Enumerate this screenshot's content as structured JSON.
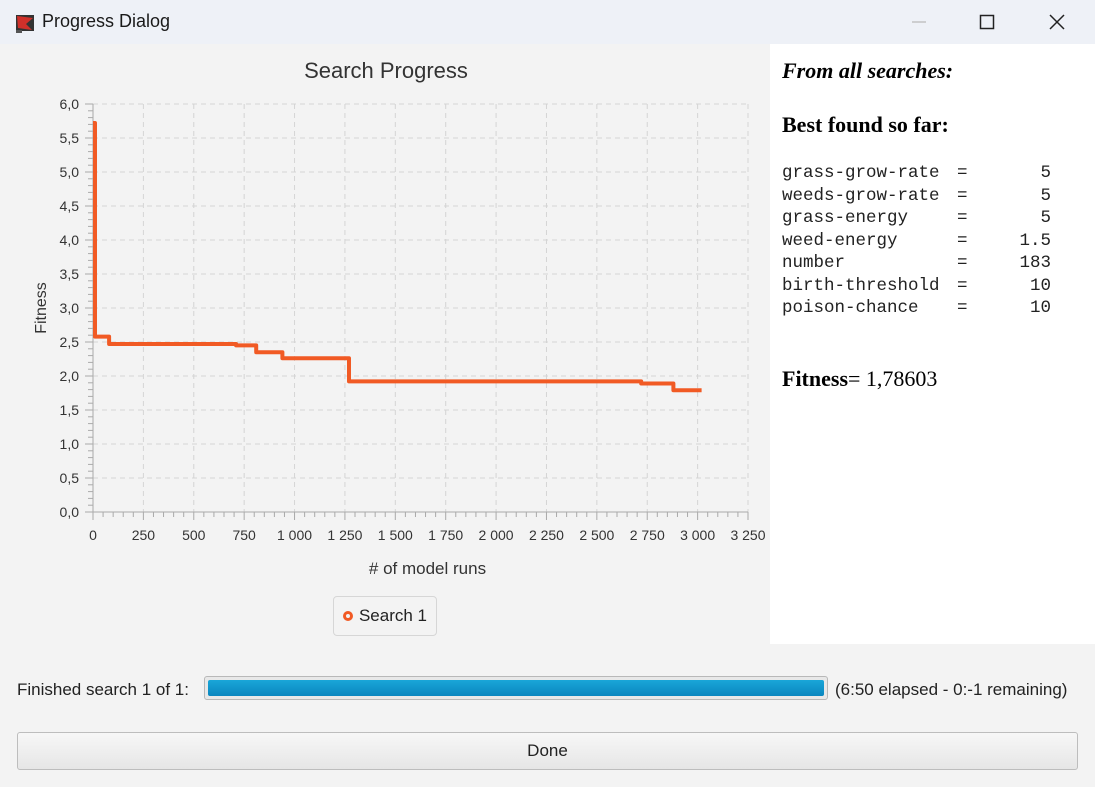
{
  "window": {
    "title": "Progress Dialog",
    "buttons": {
      "minimize": "minimize-icon",
      "maximize": "maximize-icon",
      "close": "close-icon"
    }
  },
  "chart_data": {
    "type": "line",
    "title": "Search Progress",
    "xlabel": "# of model runs",
    "ylabel": "Fitness",
    "xlim": [
      0,
      3250
    ],
    "ylim": [
      0,
      6.0
    ],
    "x_ticks": [
      0,
      250,
      500,
      750,
      1000,
      1250,
      1500,
      1750,
      2000,
      2250,
      2500,
      2750,
      3000,
      3250
    ],
    "x_tick_labels": [
      "0",
      "250",
      "500",
      "750",
      "1 000",
      "1 250",
      "1 500",
      "1 750",
      "2 000",
      "2 250",
      "2 500",
      "2 750",
      "3 000",
      "3 250"
    ],
    "y_ticks": [
      0,
      0.5,
      1.0,
      1.5,
      2.0,
      2.5,
      3.0,
      3.5,
      4.0,
      4.5,
      5.0,
      5.5,
      6.0
    ],
    "y_tick_labels": [
      "0,0",
      "0,5",
      "1,0",
      "1,5",
      "2,0",
      "2,5",
      "3,0",
      "3,5",
      "4,0",
      "4,5",
      "5,0",
      "5,5",
      "6,0"
    ],
    "grid": true,
    "legend_position": "bottom",
    "series": [
      {
        "name": "Search 1",
        "color": "#f15a24",
        "x": [
          0,
          10,
          10,
          80,
          80,
          710,
          710,
          810,
          810,
          940,
          940,
          1270,
          1270,
          2720,
          2720,
          2880,
          2880,
          3020
        ],
        "y": [
          5.72,
          5.72,
          2.58,
          2.58,
          2.47,
          2.47,
          2.45,
          2.45,
          2.35,
          2.35,
          2.26,
          2.26,
          1.92,
          1.92,
          1.89,
          1.89,
          1.79,
          1.79
        ]
      }
    ]
  },
  "results": {
    "heading_all": "From all searches:",
    "heading_best": "Best found so far:",
    "params": [
      {
        "name": "grass-grow-rate",
        "eq": "=",
        "value": "5"
      },
      {
        "name": "weeds-grow-rate",
        "eq": "=",
        "value": "5"
      },
      {
        "name": "grass-energy",
        "eq": "=",
        "value": "5"
      },
      {
        "name": "weed-energy",
        "eq": "=",
        "value": "1.5"
      },
      {
        "name": "number",
        "eq": "=",
        "value": "183"
      },
      {
        "name": "birth-threshold",
        "eq": "=",
        "value": "10"
      },
      {
        "name": "poison-chance",
        "eq": "=",
        "value": "10"
      }
    ],
    "fitness_label": "Fitness",
    "fitness_value": "= 1,78603"
  },
  "status": {
    "label": "Finished search 1 of 1:",
    "progress": 1.0,
    "elapsed_text": "(6:50 elapsed - 0:-1 remaining)"
  },
  "done_label": "Done"
}
